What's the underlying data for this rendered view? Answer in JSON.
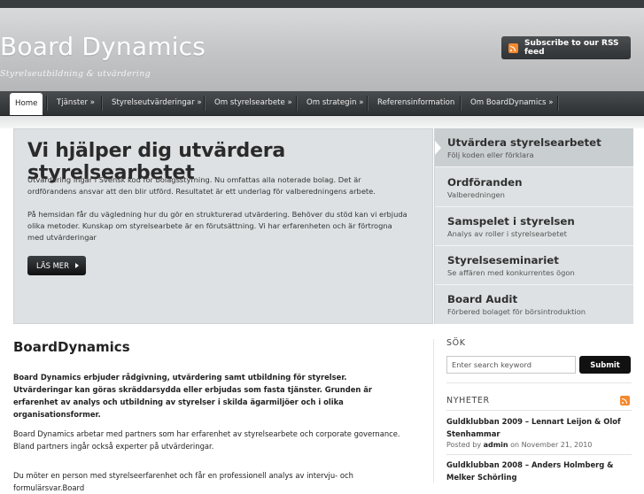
{
  "site": {
    "title": "Board Dynamics",
    "tagline": "Styrelseutbildning & utvärdering",
    "rss_label": "Subscribe to our RSS feed"
  },
  "nav": {
    "items": [
      {
        "label": "Home",
        "active": true
      },
      {
        "label": "Tjänster »"
      },
      {
        "label": "Styrelseutvärderingar »"
      },
      {
        "label": "Om styrelsearbete »"
      },
      {
        "label": "Om strategin »"
      },
      {
        "label": "Referensinformation"
      },
      {
        "label": "Om BoardDynamics »"
      }
    ]
  },
  "featured": {
    "heading": "Vi hjälper dig utvärdera styrelsearbetet",
    "paragraph1": "Utvärdering ingår i Svensk kod för bolagsstyrning. Nu omfattas alla noterade bolag. Det är ordförandens ansvar att den blir utförd. Resultatet är ett underlag för valberedningens arbete.",
    "paragraph2": "På hemsidan får du vägledning hur du gör en strukturerad utvärdering. Behöver du stöd kan vi erbjuda olika metoder. Kunskap om styrelsearbete är en förutsättning. Vi har erfarenheten och är förtrogna med utvärderingar",
    "read_more": "LÄS MER",
    "list": [
      {
        "title": "Utvärdera styrelsearbetet",
        "subtitle": "Följ koden eller förklara",
        "active": true
      },
      {
        "title": "Ordföranden",
        "subtitle": "Valberedningen"
      },
      {
        "title": "Samspelet i styrelsen",
        "subtitle": "Analys av roller i styrelsearbetet"
      },
      {
        "title": "Styrelseseminariet",
        "subtitle": "Se affären med konkurrentes ögon"
      },
      {
        "title": "Board Audit",
        "subtitle": "Förbered bolaget för börsintroduktion"
      }
    ]
  },
  "main": {
    "title": "BoardDynamics",
    "intro_bold": "Board Dynamics erbjuder rådgivning, utvärdering samt utbildning för styrelser. Utvärderingar kan göras skräddarsydda eller erbjudas som fasta tjänster. Grunden är erfarenhet av analys och utbildning av styrelser i skilda ägarmiljöer och i olika organisationsformer.",
    "paragraph2": "Board Dynamics arbetar med partners som har erfarenhet av styrelsearbete och corporate governance. Bland partners ingår också experter på utvärderingar.",
    "paragraph3": "Du möter en person med styrelseerfarenhet och får en professionell analys av intervju- och formulärsvar.Board"
  },
  "sidebar": {
    "search_heading": "SÖK",
    "search_placeholder": "Enter search keyword",
    "search_button": "Submit",
    "news_heading": "NYHETER",
    "news": [
      {
        "title": "Guldklubban 2009 – Lennart Leijon & Olof Stenhammar",
        "posted_by": "Posted by",
        "author": "admin",
        "on": "on",
        "date": "November 21, 2010"
      },
      {
        "title": "Guldklubban 2008 – Anders Holmberg & Melker Schörling"
      }
    ]
  },
  "colors": {
    "nav_bg": "#2d3033",
    "featured_bg": "#dde1e3",
    "rss_orange": "#f4892f",
    "button_dark": "#111111"
  }
}
